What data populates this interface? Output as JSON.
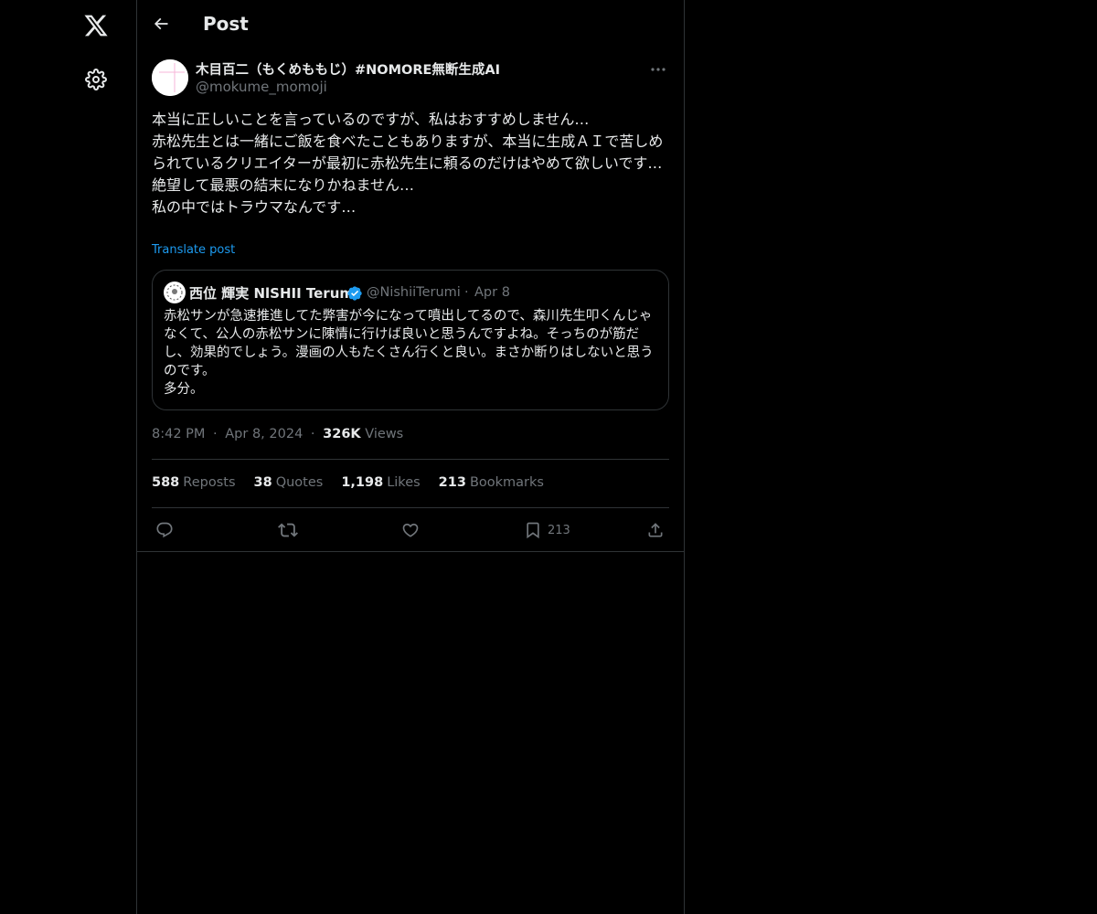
{
  "nav": {
    "items": [
      {
        "icon": "x-logo-icon"
      },
      {
        "icon": "gear-icon"
      }
    ]
  },
  "header": {
    "title": "Post"
  },
  "post": {
    "author": {
      "display_name": "木目百二（もくめももじ）#NOMORE無断生成AI",
      "handle": "@mokume_momoji"
    },
    "text": "本当に正しいことを言っているのですが、私はおすすめしません…\n赤松先生とは一緒にご飯を食べたこともありますが、本当に生成ＡＩで苦しめられているクリエイターが最初に赤松先生に頼るのだけはやめて欲しいです…\n絶望して最悪の結末になりかねません…\n私の中ではトラウマなんです…",
    "translate_label": "Translate post",
    "quote": {
      "display_name": "西位 輝実 NlSHII Terumi",
      "handle": "@NishiiTerumi",
      "separator": "·",
      "date": "Apr 8",
      "text": "赤松サンが急速推進してた弊害が今になって噴出してるので、森川先生叩くんじゃなくて、公人の赤松サンに陳情に行けば良いと思うんですよね。そっちのが筋だし、効果的でしょう。漫画の人もたくさん行くと良い。まさか断りはしないと思うのです。\n多分。"
    },
    "meta": {
      "time": "8:42 PM",
      "dot1": "·",
      "date": "Apr 8, 2024",
      "dot2": "·",
      "views_count": "326K",
      "views_label": "Views"
    },
    "stats": {
      "reposts_count": "588",
      "reposts_label": "Reposts",
      "quotes_count": "38",
      "quotes_label": "Quotes",
      "likes_count": "1,198",
      "likes_label": "Likes",
      "bookmarks_count": "213",
      "bookmarks_label": "Bookmarks"
    },
    "actions": {
      "bookmark_count": "213"
    }
  },
  "colors": {
    "background": "#000000",
    "text": "#e7e9ea",
    "muted": "#71767b",
    "accent": "#1d9bf0",
    "border": "#2f3336"
  }
}
